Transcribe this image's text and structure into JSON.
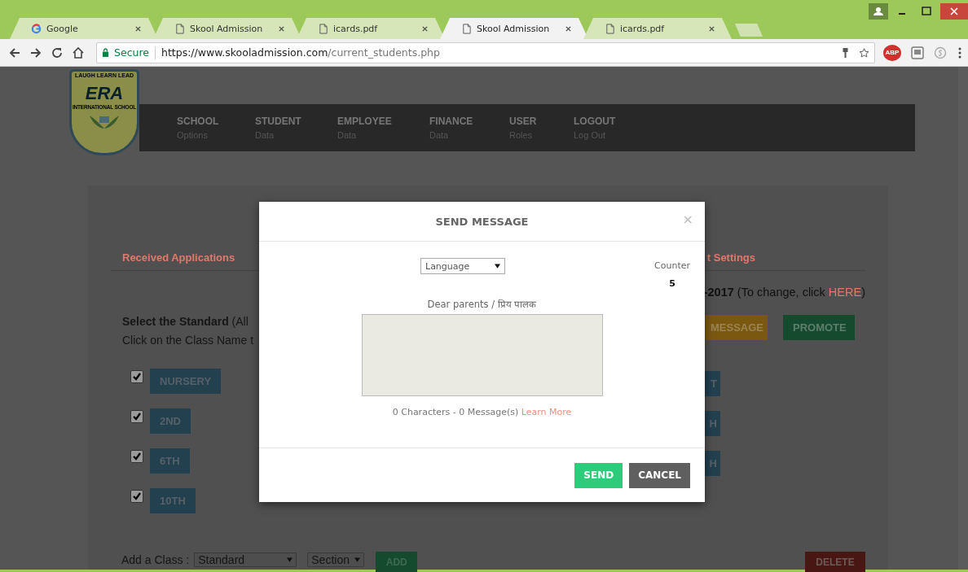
{
  "browser": {
    "tabs": [
      {
        "title": "Google",
        "kind": "google",
        "selected": false
      },
      {
        "title": "Skool Admission",
        "kind": "page",
        "selected": false
      },
      {
        "title": "icards.pdf",
        "kind": "page",
        "selected": false
      },
      {
        "title": "Skool Admission",
        "kind": "page",
        "selected": true
      },
      {
        "title": "icards.pdf",
        "kind": "page",
        "selected": false
      }
    ],
    "address_bar": {
      "security": "Secure",
      "url_host": "https://www.skooladmission.com",
      "url_path": "/current_students.php"
    },
    "extension_badge": "ABP"
  },
  "site": {
    "logo": {
      "motto": [
        "LAUGH",
        "LEARN",
        "LEAD"
      ],
      "name": "ERA",
      "subtitle": "INTERNATIONAL SCHOOL"
    },
    "nav": [
      {
        "label": "SCHOOL",
        "sub": "Options"
      },
      {
        "label": "STUDENT",
        "sub": "Data"
      },
      {
        "label": "EMPLOYEE",
        "sub": "Data"
      },
      {
        "label": "FINANCE",
        "sub": "Data"
      },
      {
        "label": "USER",
        "sub": "Roles"
      },
      {
        "label": "LOGOUT",
        "sub": "Log Out"
      }
    ]
  },
  "page_tabs": [
    "Received Applications",
    "t Settings"
  ],
  "year_note": {
    "text": "**-2017** (To change, click ",
    "link": "HERE",
    "end": ")"
  },
  "instructions": [
    "**Select the Standard** (All",
    "Click on the Class Name t"
  ],
  "action_buttons": [
    {
      "label": "MESSAGE",
      "color": "#7a5810"
    },
    {
      "label": "PROMOTE",
      "color": "#154a2f"
    }
  ],
  "classes": [
    {
      "name": "NURSERY",
      "checked": true
    },
    {
      "name": "2ND",
      "checked": true
    },
    {
      "name": "6TH",
      "checked": true
    },
    {
      "name": "10TH",
      "checked": true
    }
  ],
  "right_classes": [
    "T",
    "H",
    "H"
  ],
  "add_class": {
    "label": "Add a Class :",
    "standard": "Standard",
    "section": "Section",
    "button": "ADD"
  },
  "delete_button": "DELETE",
  "modal": {
    "title": "SEND MESSAGE",
    "close": "×",
    "language": "Language",
    "counter_label": "Counter",
    "counter": "5",
    "prompt": "Dear parents / प्रिय पालक",
    "char_info": "0 Characters - 0 Message(s)",
    "learn_more": "Learn More",
    "buttons": [
      {
        "label": "SEND",
        "kind": "primary"
      },
      {
        "label": "CANCEL",
        "kind": "secondary"
      }
    ]
  }
}
